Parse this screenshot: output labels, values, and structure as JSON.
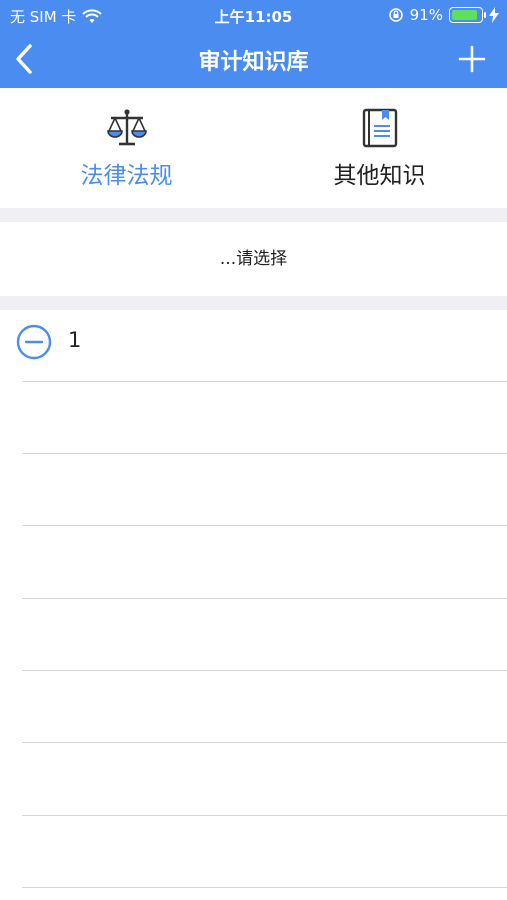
{
  "status_bar": {
    "carrier": "无 SIM 卡",
    "time": "上午11:05",
    "battery_percent_text": "91%",
    "battery_level": 0.91,
    "wifi_icon": "wifi-icon",
    "lock_icon": "orientation-lock-icon",
    "charging_icon": "charging-bolt-icon"
  },
  "nav": {
    "title": "审计知识库",
    "back_icon": "chevron-left-icon",
    "add_icon": "plus-icon",
    "color": "#4a8cf0"
  },
  "tabs": [
    {
      "label": "法律法规",
      "icon": "scales-icon",
      "active": true
    },
    {
      "label": "其他知识",
      "icon": "book-icon",
      "active": false
    }
  ],
  "selector": {
    "placeholder": "...请选择"
  },
  "list": {
    "items": [
      {
        "text": "1",
        "icon": "minus-circle-icon"
      }
    ],
    "empty_rows": 7
  },
  "colors": {
    "accent": "#4a8cf0",
    "divider": "#d8d8d8",
    "section_gap": "#efeff4"
  }
}
